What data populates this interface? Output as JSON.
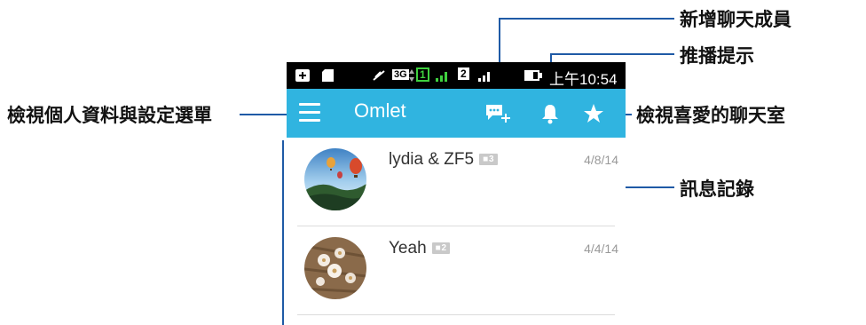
{
  "callouts": {
    "menu": "檢視個人資料與設定選單",
    "new_member": "新增聊天成員",
    "notification": "推播提示",
    "favorites": "檢視喜愛的聊天室",
    "history": "訊息記錄"
  },
  "status_bar": {
    "time": "上午10:54",
    "network": "3G",
    "sim1": "1",
    "sim2": "2"
  },
  "app_bar": {
    "title": "Omlet"
  },
  "chats": [
    {
      "name": "lydia & ZF5",
      "members": "3",
      "date": "4/8/14"
    },
    {
      "name": "Yeah",
      "members": "2",
      "date": "4/4/14"
    }
  ],
  "colors": {
    "app_bar": "#30b4e0",
    "callout_line": "#1f5aa6",
    "status_bar": "#000000"
  }
}
